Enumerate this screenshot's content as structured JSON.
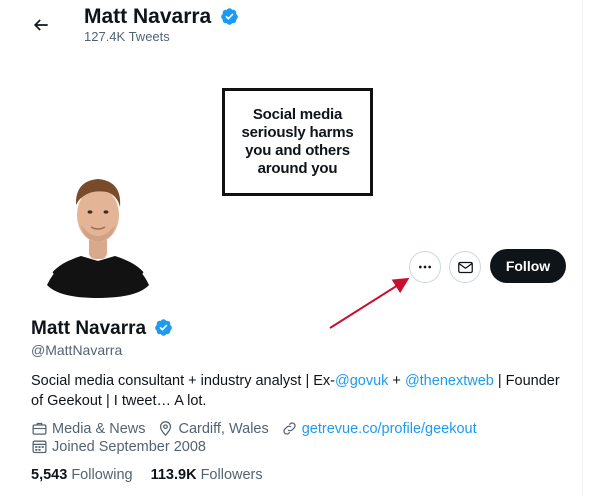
{
  "header": {
    "name": "Matt Navarra",
    "tweet_count": "127.4K Tweets"
  },
  "banner": {
    "sign_lines": [
      "Social media",
      "seriously harms",
      "you and others",
      "around you"
    ]
  },
  "actions": {
    "more_icon": "more-horizontal-icon",
    "message_icon": "envelope-icon",
    "follow_label": "Follow"
  },
  "profile": {
    "name": "Matt Navarra",
    "handle": "@MattNavarra",
    "bio": {
      "text_1": "Social media consultant + industry analyst | Ex-",
      "link_1": "@govuk",
      "text_2": " + ",
      "link_2": "@thenextweb",
      "text_3": " | Founder of Geekout | I tweet… A lot."
    },
    "category": "Media & News",
    "location": "Cardiff, Wales",
    "website": "getrevue.co/profile/geekout",
    "joined": "Joined September 2008",
    "following_count": "5,543",
    "following_label": "Following",
    "followers_count": "113.9K",
    "followers_label": "Followers"
  },
  "colors": {
    "accent": "#1d9bf0",
    "text": "#0f1419",
    "secondary": "#536471",
    "annotation_arrow": "#c8102e"
  }
}
